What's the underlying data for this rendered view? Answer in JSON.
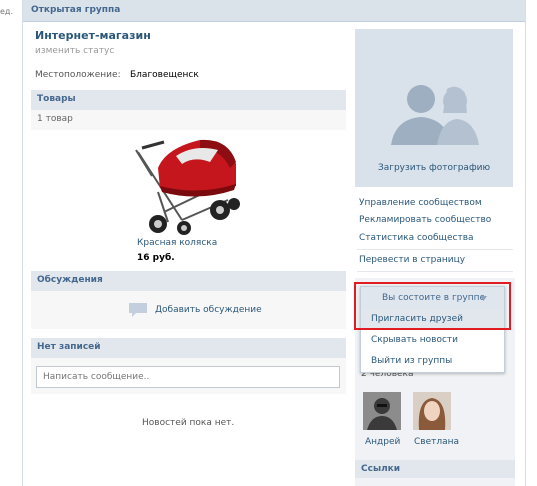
{
  "edge_text": "ед.",
  "group": {
    "type_label": "Открытая группа",
    "name": "Интернет-магазин",
    "status_link": "изменить статус",
    "location_label": "Местоположение:",
    "location_value": "Благовещенск"
  },
  "products": {
    "title": "Товары",
    "count": "1 товар",
    "item_name": "Красная коляска",
    "item_price": "16 руб."
  },
  "discussions": {
    "title": "Обсуждения",
    "add_label": "Добавить обсуждение"
  },
  "wall": {
    "title": "Нет записей",
    "input_placeholder": "Написать сообщение..",
    "empty_text": "Новостей пока нет."
  },
  "sidebar": {
    "upload_photo": "Загрузить фотографию",
    "links": [
      "Управление сообществом",
      "Рекламировать сообщество",
      "Статистика сообщества"
    ],
    "to_page": "Перевести в страницу",
    "members_count": "2 человека",
    "members": [
      "Андрей",
      "Светлана"
    ],
    "links_title": "Ссылки"
  },
  "dropdown": {
    "header": "Вы состоите в группе",
    "items": [
      "Пригласить друзей",
      "Скрывать новости",
      "Выйти из группы"
    ]
  },
  "colors": {
    "link": "#2b587a",
    "header_bg": "#dae2ea",
    "highlight": "#e01b22",
    "product_red": "#c4161c"
  }
}
